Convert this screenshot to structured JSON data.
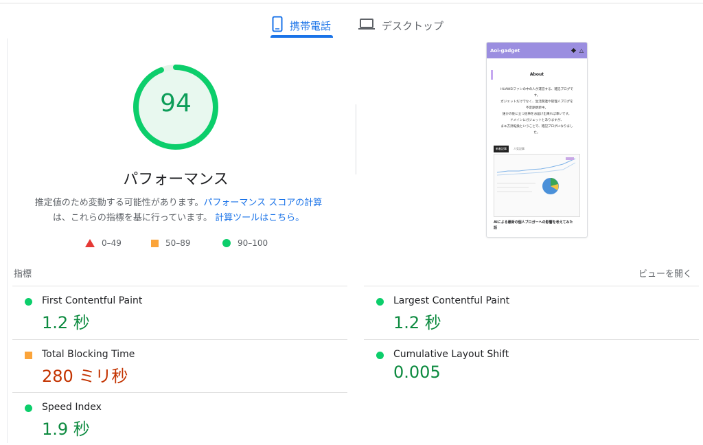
{
  "tabs": {
    "mobile": "携帯電話",
    "desktop": "デスクトップ"
  },
  "score": {
    "value": "94",
    "fraction": 0.94,
    "title": "パフォーマンス",
    "color": "#0cce6b"
  },
  "description": {
    "text1": "推定値のため変動する可能性があります。",
    "link1": "パフォーマンス スコアの計算",
    "text2": "は、これらの指標を基に行っています。",
    "link2": "計算ツールはこちら。"
  },
  "legend": [
    {
      "icon": "triangle-red",
      "label": "0–49"
    },
    {
      "icon": "square-orange",
      "label": "50–89"
    },
    {
      "icon": "circle-green",
      "label": "90–100"
    }
  ],
  "metrics_header": {
    "label": "指標",
    "toggle": "ビューを開く"
  },
  "metrics": [
    {
      "name": "First Contentful Paint",
      "value": "1.2 秒",
      "status": "good"
    },
    {
      "name": "Largest Contentful Paint",
      "value": "1.2 秒",
      "status": "good"
    },
    {
      "name": "Total Blocking Time",
      "value": "280 ミリ秒",
      "status": "average"
    },
    {
      "name": "Cumulative Layout Shift",
      "value": "0.005",
      "status": "good"
    },
    {
      "name": "Speed Index",
      "value": "1.9 秒",
      "status": "good"
    }
  ],
  "screenshot": {
    "site_title": "Aoi-gadget",
    "about": "About",
    "lines": [
      "HUAWEIファンの中の人が運営する、雑記ブログで",
      "す。",
      "",
      "ガジェットだけでなく、生活関連や管理人ブログを",
      "不定期更新中。",
      "誰かの役に立つ記事をお届け出来れば幸いです。",
      "ドメインにガジェットとありますが、",
      "まぁ方針転換ということで、雑記ブログになりまし",
      "た。"
    ],
    "tab_new": "新着記事",
    "tab_popular": "人気記事",
    "card_title": "AIによる最新の個人ブロガーへの影響を考えてみた話"
  }
}
